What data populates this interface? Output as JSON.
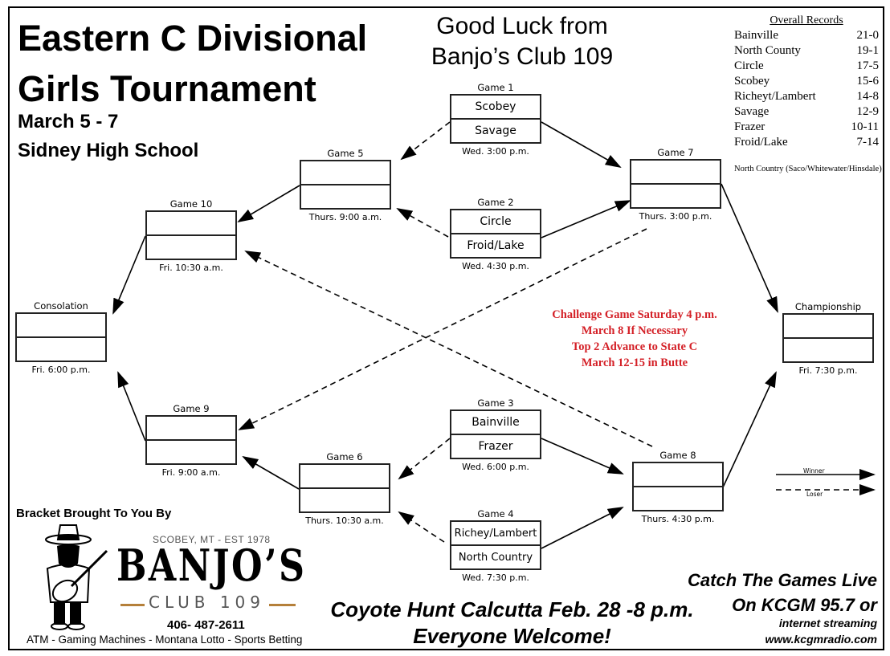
{
  "header": {
    "title_line1": "Eastern C Divisional",
    "title_line2": "Girls Tournament",
    "dates": "March 5 - 7",
    "venue": "Sidney High School",
    "good_luck_line1": "Good Luck from",
    "good_luck_line2": "Banjo’s Club 109"
  },
  "records": {
    "heading": "Overall Records",
    "rows": [
      {
        "team": "Bainville",
        "record": "21-0"
      },
      {
        "team": "North County",
        "record": "19-1"
      },
      {
        "team": "Circle",
        "record": "17-5"
      },
      {
        "team": "Scobey",
        "record": "15-6"
      },
      {
        "team": "Richeyt/Lambert",
        "record": "14-8"
      },
      {
        "team": "Savage",
        "record": "12-9"
      },
      {
        "team": "Frazer",
        "record": "10-11"
      },
      {
        "team": "Froid/Lake",
        "record": "7-14"
      }
    ],
    "note": "North Country (Saco/Whitewater/Hinsdale)"
  },
  "games": {
    "g1": {
      "label": "Game 1",
      "top": "Scobey",
      "bottom": "Savage",
      "time": "Wed. 3:00 p.m."
    },
    "g2": {
      "label": "Game 2",
      "top": "Circle",
      "bottom": "Froid/Lake",
      "time": "Wed. 4:30 p.m."
    },
    "g3": {
      "label": "Game 3",
      "top": "Bainville",
      "bottom": "Frazer",
      "time": "Wed. 6:00 p.m."
    },
    "g4": {
      "label": "Game 4",
      "top": "Richey/Lambert",
      "bottom": "North Country",
      "time": "Wed. 7:30 p.m."
    },
    "g5": {
      "label": "Game 5",
      "top": "",
      "bottom": "",
      "time": "Thurs. 9:00 a.m."
    },
    "g6": {
      "label": "Game 6",
      "top": "",
      "bottom": "",
      "time": "Thurs. 10:30 a.m."
    },
    "g7": {
      "label": "Game 7",
      "top": "",
      "bottom": "",
      "time": "Thurs. 3:00 p.m."
    },
    "g8": {
      "label": "Game 8",
      "top": "",
      "bottom": "",
      "time": "Thurs. 4:30 p.m."
    },
    "g9": {
      "label": "Game 9",
      "top": "",
      "bottom": "",
      "time": "Fri. 9:00 a.m."
    },
    "g10": {
      "label": "Game 10",
      "top": "",
      "bottom": "",
      "time": "Fri. 10:30 a.m."
    },
    "consolation": {
      "label": "Consolation",
      "top": "",
      "bottom": "",
      "time": "Fri. 6:00 p.m."
    },
    "championship": {
      "label": "Championship",
      "top": "",
      "bottom": "",
      "time": "Fri. 7:30 p.m."
    }
  },
  "challenge": {
    "line1": "Challenge Game Saturday 4 p.m.",
    "line2": "March 8 If Necessary",
    "line3": "Top 2 Advance to State C",
    "line4": "March 12-15 in Butte",
    "color": "#d42027"
  },
  "legend": {
    "winner": "Winner",
    "loser": "Loser"
  },
  "sponsor": {
    "brought_by": "Bracket Brought To You By",
    "location": "SCOBEY, MT - EST 1978",
    "name": "BANJO’S",
    "club": "CLUB 109",
    "phone": "406- 487-2611",
    "services": "ATM - Gaming Machines - Montana Lotto -  Sports Betting",
    "accent_color": "#b5803a"
  },
  "promo": {
    "coyote_line1": "Coyote Hunt Calcutta Feb. 28 -8 p.m.",
    "coyote_line2": "Everyone Welcome!",
    "radio_line1": "Catch The Games Live",
    "radio_line2": "On KCGM 95.7 or",
    "radio_line3": "internet streaming",
    "radio_line4": "www.kcgmradio.com"
  }
}
